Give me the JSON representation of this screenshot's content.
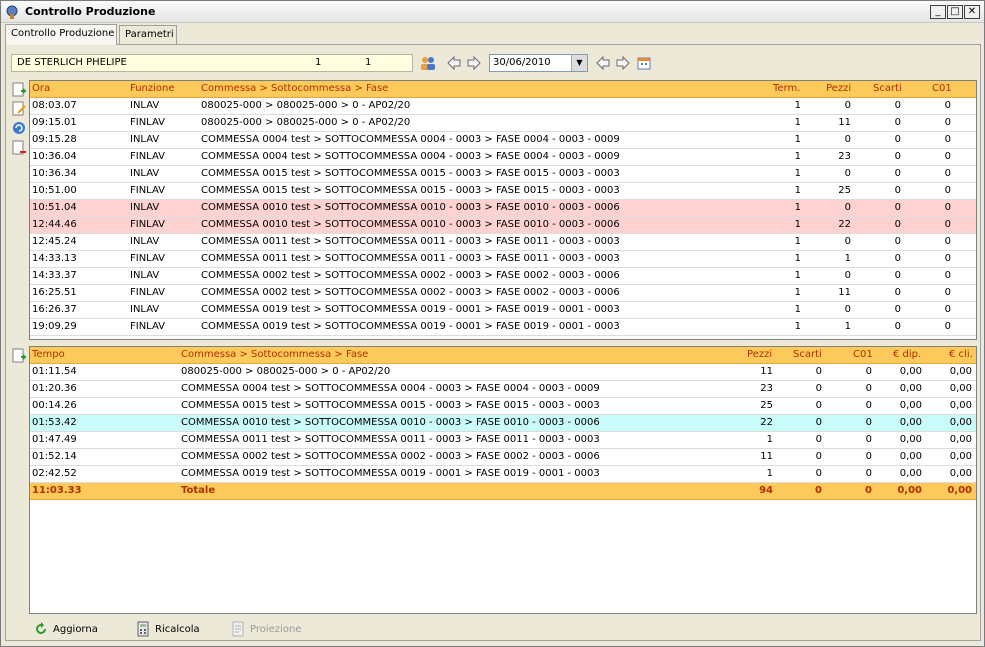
{
  "window": {
    "title": "Controllo Produzione"
  },
  "tabs": [
    "Controllo Produzione",
    "Parametri"
  ],
  "toolbar": {
    "operator_name": "DE STERLICH PHELIPE",
    "operator_value_1": "1",
    "operator_value_2": "1",
    "date": "30/06/2010"
  },
  "detail_grid": {
    "headers": {
      "ora": "Ora",
      "funzione": "Funzione",
      "commessa": "Commessa > Sottocommessa > Fase",
      "term": "Term.",
      "pezzi": "Pezzi",
      "scarti": "Scarti",
      "c01": "C01"
    },
    "rows": [
      {
        "ora": "08:03.07",
        "funzione": "INLAV",
        "commessa": "080025-000 > 080025-000 > 0 - AP02/20",
        "term": "1",
        "pezzi": "0",
        "scarti": "0",
        "c01": "0",
        "style": ""
      },
      {
        "ora": "09:15.01",
        "funzione": "FINLAV",
        "commessa": "080025-000 > 080025-000 > 0 - AP02/20",
        "term": "1",
        "pezzi": "11",
        "scarti": "0",
        "c01": "0",
        "style": ""
      },
      {
        "ora": "09:15.28",
        "funzione": "INLAV",
        "commessa": "COMMESSA 0004 test > SOTTOCOMMESSA 0004 - 0003 > FASE 0004 - 0003 - 0009",
        "term": "1",
        "pezzi": "0",
        "scarti": "0",
        "c01": "0",
        "style": ""
      },
      {
        "ora": "10:36.04",
        "funzione": "FINLAV",
        "commessa": "COMMESSA 0004 test > SOTTOCOMMESSA 0004 - 0003 > FASE 0004 - 0003 - 0009",
        "term": "1",
        "pezzi": "23",
        "scarti": "0",
        "c01": "0",
        "style": ""
      },
      {
        "ora": "10:36.34",
        "funzione": "INLAV",
        "commessa": "COMMESSA 0015 test > SOTTOCOMMESSA 0015 - 0003 > FASE 0015 - 0003 - 0003",
        "term": "1",
        "pezzi": "0",
        "scarti": "0",
        "c01": "0",
        "style": ""
      },
      {
        "ora": "10:51.00",
        "funzione": "FINLAV",
        "commessa": "COMMESSA 0015 test > SOTTOCOMMESSA 0015 - 0003 > FASE 0015 - 0003 - 0003",
        "term": "1",
        "pezzi": "25",
        "scarti": "0",
        "c01": "0",
        "style": ""
      },
      {
        "ora": "10:51.04",
        "funzione": "INLAV",
        "commessa": "COMMESSA 0010 test > SOTTOCOMMESSA 0010 - 0003 > FASE 0010 - 0003 - 0006",
        "term": "1",
        "pezzi": "0",
        "scarti": "0",
        "c01": "0",
        "style": "pink"
      },
      {
        "ora": "12:44.46",
        "funzione": "FINLAV",
        "commessa": "COMMESSA 0010 test > SOTTOCOMMESSA 0010 - 0003 > FASE 0010 - 0003 - 0006",
        "term": "1",
        "pezzi": "22",
        "scarti": "0",
        "c01": "0",
        "style": "pink"
      },
      {
        "ora": "12:45.24",
        "funzione": "INLAV",
        "commessa": "COMMESSA 0011 test > SOTTOCOMMESSA 0011 - 0003 > FASE 0011 - 0003 - 0003",
        "term": "1",
        "pezzi": "0",
        "scarti": "0",
        "c01": "0",
        "style": ""
      },
      {
        "ora": "14:33.13",
        "funzione": "FINLAV",
        "commessa": "COMMESSA 0011 test > SOTTOCOMMESSA 0011 - 0003 > FASE 0011 - 0003 - 0003",
        "term": "1",
        "pezzi": "1",
        "scarti": "0",
        "c01": "0",
        "style": ""
      },
      {
        "ora": "14:33.37",
        "funzione": "INLAV",
        "commessa": "COMMESSA 0002 test > SOTTOCOMMESSA 0002 - 0003 > FASE 0002 - 0003 - 0006",
        "term": "1",
        "pezzi": "0",
        "scarti": "0",
        "c01": "0",
        "style": ""
      },
      {
        "ora": "16:25.51",
        "funzione": "FINLAV",
        "commessa": "COMMESSA 0002 test > SOTTOCOMMESSA 0002 - 0003 > FASE 0002 - 0003 - 0006",
        "term": "1",
        "pezzi": "11",
        "scarti": "0",
        "c01": "0",
        "style": ""
      },
      {
        "ora": "16:26.37",
        "funzione": "INLAV",
        "commessa": "COMMESSA 0019 test > SOTTOCOMMESSA 0019 - 0001 > FASE 0019 - 0001 - 0003",
        "term": "1",
        "pezzi": "0",
        "scarti": "0",
        "c01": "0",
        "style": ""
      },
      {
        "ora": "19:09.29",
        "funzione": "FINLAV",
        "commessa": "COMMESSA 0019 test > SOTTOCOMMESSA 0019 - 0001 > FASE 0019 - 0001 - 0003",
        "term": "1",
        "pezzi": "1",
        "scarti": "0",
        "c01": "0",
        "style": ""
      }
    ]
  },
  "summary_grid": {
    "headers": {
      "tempo": "Tempo",
      "commessa": "Commessa > Sottocommessa > Fase",
      "pezzi": "Pezzi",
      "scarti": "Scarti",
      "c01": "C01",
      "eur_dip": "€ dip.",
      "eur_cli": "€ cli."
    },
    "rows": [
      {
        "tempo": "01:11.54",
        "commessa": "080025-000 > 080025-000 > 0 - AP02/20",
        "pezzi": "11",
        "scarti": "0",
        "c01": "0",
        "eur_dip": "0,00",
        "eur_cli": "0,00",
        "style": ""
      },
      {
        "tempo": "01:20.36",
        "commessa": "COMMESSA 0004 test > SOTTOCOMMESSA 0004 - 0003 > FASE 0004 - 0003 - 0009",
        "pezzi": "23",
        "scarti": "0",
        "c01": "0",
        "eur_dip": "0,00",
        "eur_cli": "0,00",
        "style": ""
      },
      {
        "tempo": "00:14.26",
        "commessa": "COMMESSA 0015 test > SOTTOCOMMESSA 0015 - 0003 > FASE 0015 - 0003 - 0003",
        "pezzi": "25",
        "scarti": "0",
        "c01": "0",
        "eur_dip": "0,00",
        "eur_cli": "0,00",
        "style": ""
      },
      {
        "tempo": "01:53.42",
        "commessa": "COMMESSA 0010 test > SOTTOCOMMESSA 0010 - 0003 > FASE 0010 - 0003 - 0006",
        "pezzi": "22",
        "scarti": "0",
        "c01": "0",
        "eur_dip": "0,00",
        "eur_cli": "0,00",
        "style": "cyan"
      },
      {
        "tempo": "01:47.49",
        "commessa": "COMMESSA 0011 test > SOTTOCOMMESSA 0011 - 0003 > FASE 0011 - 0003 - 0003",
        "pezzi": "1",
        "scarti": "0",
        "c01": "0",
        "eur_dip": "0,00",
        "eur_cli": "0,00",
        "style": ""
      },
      {
        "tempo": "01:52.14",
        "commessa": "COMMESSA 0002 test > SOTTOCOMMESSA 0002 - 0003 > FASE 0002 - 0003 - 0006",
        "pezzi": "11",
        "scarti": "0",
        "c01": "0",
        "eur_dip": "0,00",
        "eur_cli": "0,00",
        "style": ""
      },
      {
        "tempo": "02:42.52",
        "commessa": "COMMESSA 0019 test > SOTTOCOMMESSA 0019 - 0001 > FASE 0019 - 0001 - 0003",
        "pezzi": "1",
        "scarti": "0",
        "c01": "0",
        "eur_dip": "0,00",
        "eur_cli": "0,00",
        "style": ""
      }
    ],
    "total": {
      "tempo": "11:03.33",
      "label": "Totale",
      "pezzi": "94",
      "scarti": "0",
      "c01": "0",
      "eur_dip": "0,00",
      "eur_cli": "0,00"
    }
  },
  "bottom_buttons": {
    "aggiorna": "Aggiorna",
    "ricalcola": "Ricalcola",
    "proiezione": "Proiezione"
  },
  "colors": {
    "header_bg": "#fcc95b",
    "header_text": "#b03000",
    "highlight_pink": "#ffd2d2",
    "highlight_cyan": "#c9fbfb",
    "operator_bg": "#ffffe0"
  }
}
